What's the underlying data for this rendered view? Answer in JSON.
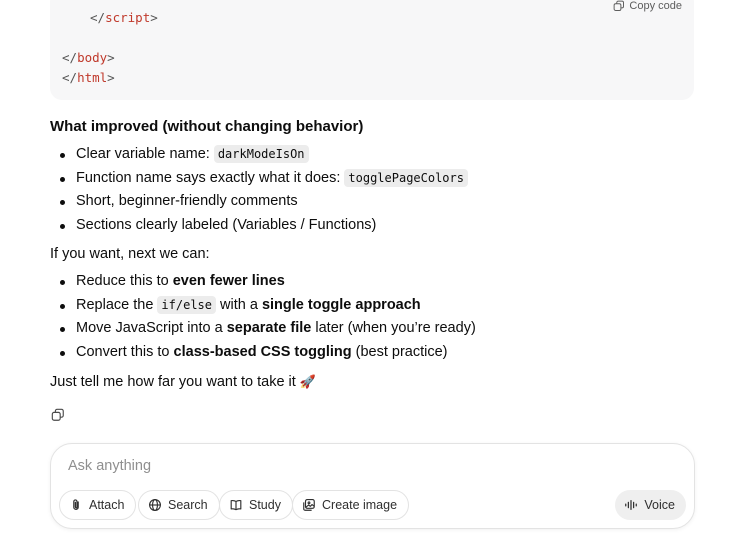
{
  "code_block": {
    "lines": [
      {
        "open": "</",
        "tag": "script",
        "close": ">"
      },
      {
        "open": "</",
        "tag": "body",
        "close": ">"
      },
      {
        "open": "</",
        "tag": "html",
        "close": ">"
      }
    ],
    "copy_label": "Copy code"
  },
  "response": {
    "heading": "What improved (without changing behavior)",
    "improvements": {
      "item1_text": "Clear variable name:",
      "item1_code": "darkModeIsOn",
      "item2_text": "Function name says exactly what it does:",
      "item2_code": "togglePageColors",
      "item3_text": "Short, beginner-friendly comments",
      "item4_text": "Sections clearly labeled (Variables / Functions)"
    },
    "next_intro": "If you want, next we can:",
    "next_steps": {
      "item1_pre": "Reduce this to",
      "item1_bold": "even fewer lines",
      "item2_pre": "Replace the",
      "item2_code": "if/else",
      "item2_mid": "with a",
      "item2_bold": "single toggle approach",
      "item3_pre": "Move JavaScript into a",
      "item3_bold": "separate file",
      "item3_post": "later (when you’re ready)",
      "item4_pre": "Convert this to",
      "item4_bold": "class-based CSS toggling",
      "item4_post": "(best practice)"
    },
    "closing": "Just tell me how far you want to take it",
    "closing_emoji": "🚀"
  },
  "composer": {
    "placeholder": "Ask anything",
    "buttons": {
      "attach": "Attach",
      "search": "Search",
      "study": "Study",
      "create_image": "Create image",
      "voice": "Voice"
    }
  }
}
